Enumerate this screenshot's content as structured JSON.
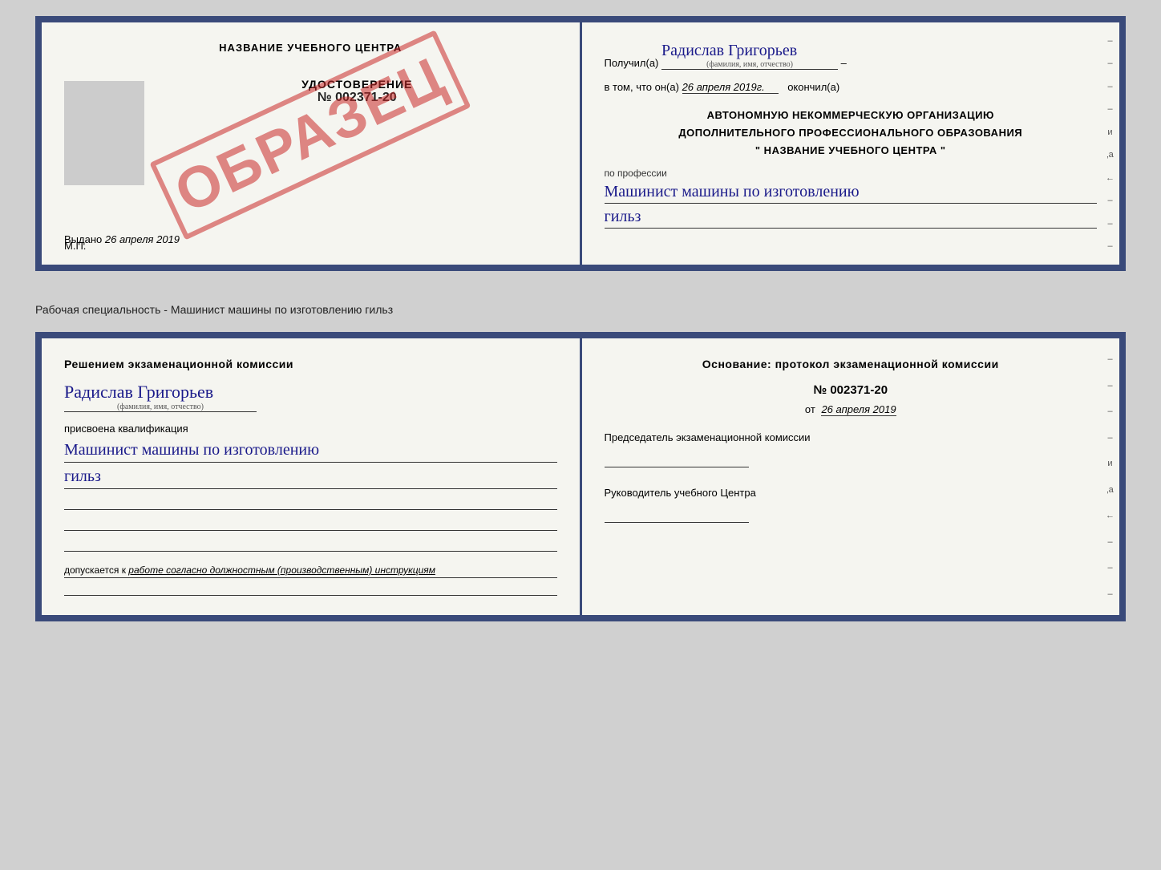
{
  "doc1": {
    "left": {
      "center_title": "НАЗВАНИЕ УЧЕБНОГО ЦЕНТРА",
      "stamp_text": "ОБРАЗЕЦ",
      "udostoverenie_label": "УДОСТОВЕРЕНИЕ",
      "number": "№ 002371-20",
      "vydano_label": "Выдано",
      "vydano_date": "26 апреля 2019",
      "mp_label": "М.П."
    },
    "right": {
      "poluchil_prefix": "Получил(а)",
      "poluchil_name": "Радислав Григорьев",
      "poluchil_sub": "(фамилия, имя, отчество)",
      "vtom_prefix": "в том, что он(а)",
      "vtom_date": "26 апреля 2019г.",
      "vtom_suffix": "окончил(а)",
      "org_line1": "АВТОНОМНУЮ НЕКОММЕРЧЕСКУЮ ОРГАНИЗАЦИЮ",
      "org_line2": "ДОПОЛНИТЕЛЬНОГО ПРОФЕССИОНАЛЬНОГО ОБРАЗОВАНИЯ",
      "org_name": "\" НАЗВАНИЕ УЧЕБНОГО ЦЕНТРА \"",
      "po_professii_label": "по профессии",
      "profession_line1": "Машинист машины по изготовлению",
      "profession_line2": "гильз"
    }
  },
  "specialty_label": "Рабочая специальность - Машинист машины по изготовлению гильз",
  "doc2": {
    "left": {
      "resheniem_title": "Решением экзаменационной комиссии",
      "person_name": "Радислав Григорьев",
      "person_sub": "(фамилия, имя, отчество)",
      "prisvoena_label": "присвоена квалификация",
      "kvalifikaciya_line1": "Машинист машины по изготовлению",
      "kvalifikaciya_line2": "гильз",
      "dopuskaetsya_prefix": "допускается к",
      "dopuskaetsya_text": "работе согласно должностным (производственным) инструкциям"
    },
    "right": {
      "osnovanie_title": "Основание: протокол экзаменационной комиссии",
      "protocol_number": "№ 002371-20",
      "ot_label": "от",
      "ot_date": "26 апреля 2019",
      "predsedatel_label": "Председатель экзаменационной комиссии",
      "rukovoditel_label": "Руководитель учебного Центра"
    }
  },
  "edge_dashes": [
    "–",
    "–",
    "–",
    "–",
    "и",
    "‚а",
    "←",
    "–",
    "–",
    "–"
  ]
}
